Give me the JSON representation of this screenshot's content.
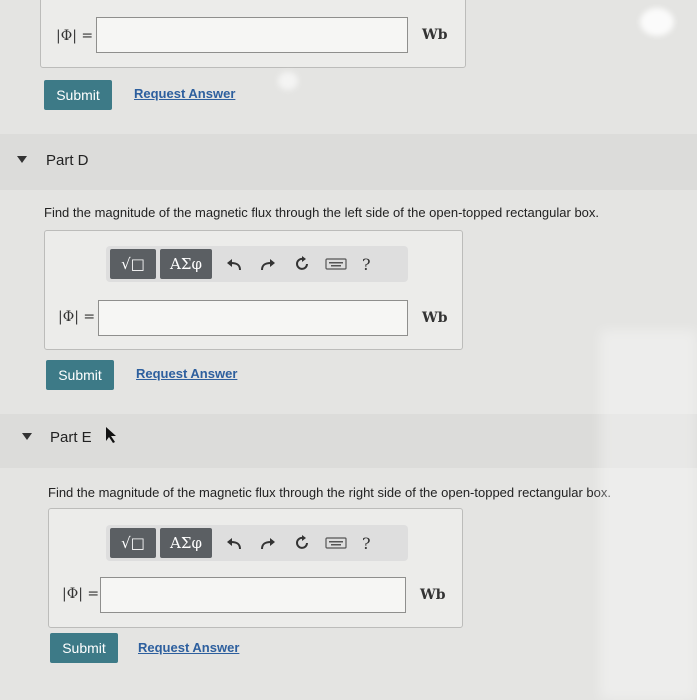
{
  "partC": {
    "phi_label": "|Φ| =",
    "answer_value": "",
    "unit": "Wb",
    "submit_label": "Submit",
    "request_label": "Request Answer"
  },
  "partD": {
    "title": "Part D",
    "question": "Find the magnitude of the magnetic flux through the left side of the open-topped rectangular box.",
    "toolbar": {
      "template_label": "√□",
      "greek_label": "ΑΣφ",
      "help_label": "?"
    },
    "phi_label": "|Φ| =",
    "answer_value": "",
    "unit": "Wb",
    "submit_label": "Submit",
    "request_label": "Request Answer"
  },
  "partE": {
    "title": "Part E",
    "question": "Find the magnitude of the magnetic flux through the right side of the open-topped rectangular box.",
    "toolbar": {
      "template_label": "√□",
      "greek_label": "ΑΣφ",
      "help_label": "?"
    },
    "phi_label": "|Φ| =",
    "answer_value": "",
    "unit": "Wb",
    "submit_label": "Submit",
    "request_label": "Request Answer"
  },
  "colors": {
    "submit": "#3d7a87",
    "link": "#2d5f9e",
    "toolbar_button": "#5b5f63"
  }
}
